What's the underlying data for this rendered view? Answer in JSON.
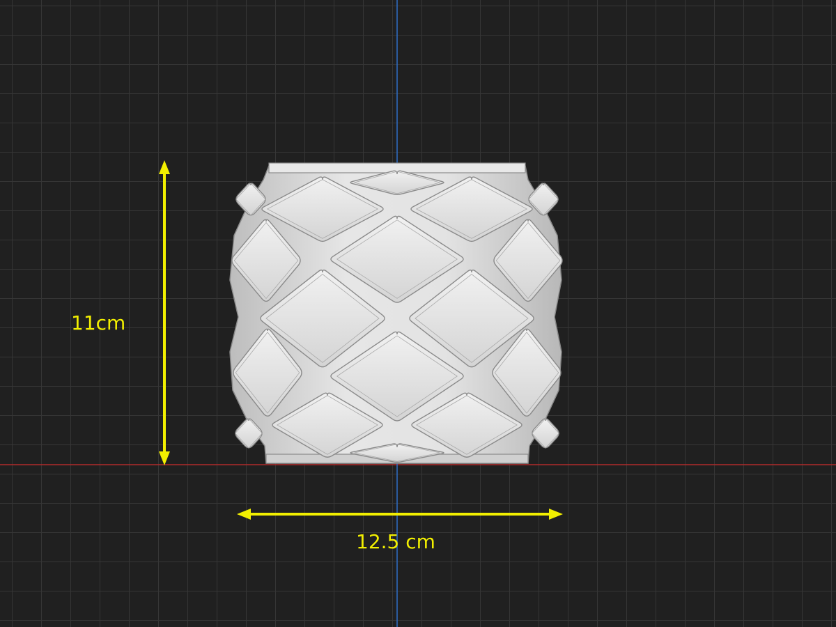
{
  "dimensions": {
    "height_label": "11cm",
    "width_label": "12.5 cm",
    "color": "#f2ef00"
  },
  "viewport": {
    "x_axis_color": "#b02a2a",
    "y_axis_color": "#2f6fc9",
    "grid_color": "#363636",
    "background_color": "#202020"
  },
  "model": {
    "name": "faceted-vase-icon",
    "face_color": "#dedede",
    "edge_color": "#8a8a8a"
  }
}
